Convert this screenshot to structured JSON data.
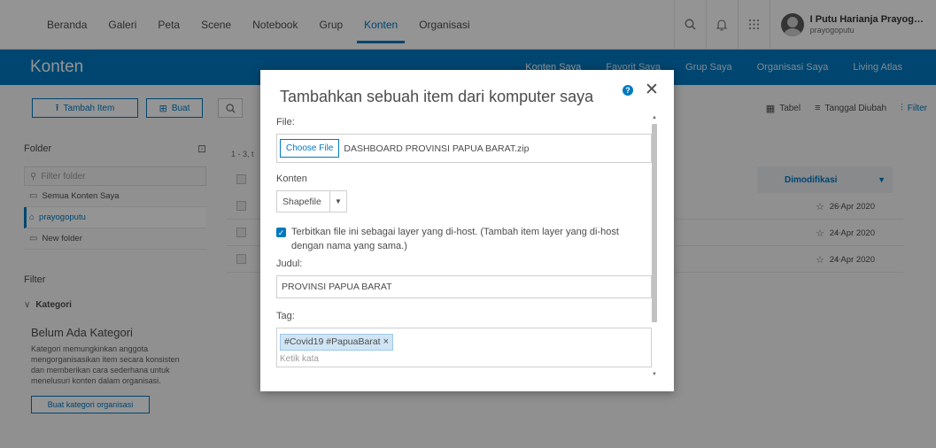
{
  "topnav": {
    "tabs": [
      "Beranda",
      "Galeri",
      "Peta",
      "Scene",
      "Notebook",
      "Grup",
      "Konten",
      "Organisasi"
    ],
    "active_tab": "Konten",
    "user": {
      "name": "I Putu Harianja Prayog…",
      "handle": "prayogoputu"
    }
  },
  "header": {
    "title": "Konten",
    "subtabs": [
      "Konten Saya",
      "Favorit Saya",
      "Grup Saya",
      "Organisasi Saya",
      "Living Atlas"
    ],
    "active_subtab": "Konten Saya"
  },
  "toolbar": {
    "add_item": "Tambah Item",
    "create": "Buat",
    "table": "Tabel",
    "sort": "Tanggal Diubah",
    "filter": "Filter"
  },
  "sidebar": {
    "folder_title": "Folder",
    "filter_placeholder": "Filter folder",
    "folders": [
      {
        "label": "Semua Konten Saya",
        "active": false
      },
      {
        "label": "prayogoputu",
        "active": true
      },
      {
        "label": "New folder",
        "active": false
      }
    ],
    "filter_title": "Filter",
    "category_title": "Kategori",
    "no_category_heading": "Belum Ada Kategori",
    "no_category_text": "Kategori memungkinkan anggota mengorganisasikan item secara konsisten dan memberikan cara sederhana untuk menelusuri konten dalam organisasi.",
    "org_category_button": "Buat kategori organisasi"
  },
  "list": {
    "range": "1 - 3, t",
    "modified_header": "Dimodifikasi",
    "rows": [
      {
        "date": "26 Apr 2020"
      },
      {
        "date": "24 Apr 2020"
      },
      {
        "date": "24 Apr 2020"
      }
    ]
  },
  "dialog": {
    "title": "Tambahkan sebuah item dari komputer saya",
    "file_label": "File:",
    "choose_file": "Choose File",
    "file_name": "DASHBOARD PROVINSI PAPUA BARAT.zip",
    "content_label": "Konten",
    "content_value": "Shapefile",
    "publish_text": "Terbitkan file ini sebagai layer yang di-host. (Tambah item layer yang di-host dengan nama yang sama.)",
    "title_label": "Judul:",
    "title_value": "PROVINSI PAPUA BARAT",
    "tag_label": "Tag:",
    "tag_value": "#Covid19 #PapuaBarat",
    "tag_next": "Ketik kata"
  },
  "colors": {
    "accent": "#0079c1",
    "overlay": "rgba(0,0,0,0.42)"
  }
}
